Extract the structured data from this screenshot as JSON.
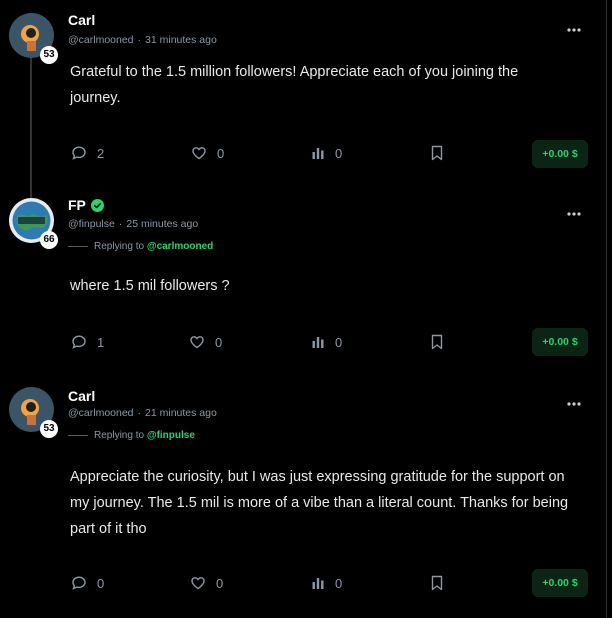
{
  "posts": [
    {
      "author": "Carl",
      "level": "53",
      "handle": "@carlmooned",
      "time": "31 minutes ago",
      "verified": false,
      "replying_to": null,
      "text": "Grateful to the 1.5 million followers! Appreciate each of you joining the journey.",
      "comments": "2",
      "likes": "0",
      "views": "0",
      "tip": "+0.00 $"
    },
    {
      "author": "FP",
      "level": "66",
      "handle": "@finpulse",
      "time": "25 minutes ago",
      "verified": true,
      "replying_label": "Replying to",
      "replying_to": "@carlmooned",
      "text": "where 1.5 mil followers ?",
      "comments": "1",
      "likes": "0",
      "views": "0",
      "tip": "+0.00 $"
    },
    {
      "author": "Carl",
      "level": "53",
      "handle": "@carlmooned",
      "time": "21 minutes ago",
      "verified": false,
      "replying_label": "Replying to",
      "replying_to": "@finpulse",
      "text": "Appreciate the curiosity, but I was just expressing gratitude for the support on my journey. The 1.5 mil is more of a vibe than a literal count. Thanks for being part of it tho",
      "comments": "0",
      "likes": "0",
      "views": "0",
      "tip": "+0.00 $"
    }
  ],
  "colors": {
    "background": "#000000",
    "accent": "#2bd36a",
    "muted": "#8b98a5",
    "tip_bg": "#0b2415"
  },
  "icons": [
    "comment-icon",
    "heart-icon",
    "views-icon",
    "bookmark-icon",
    "more-icon",
    "verified-icon"
  ]
}
